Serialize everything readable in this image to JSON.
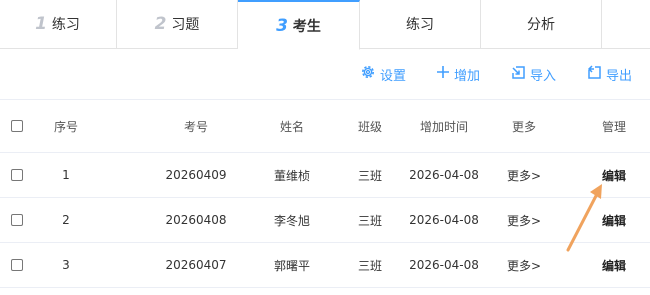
{
  "tabs": [
    {
      "num": "1",
      "label": "练习"
    },
    {
      "num": "2",
      "label": "习题"
    },
    {
      "num": "3",
      "label": "考生"
    },
    {
      "num": "",
      "label": "练习"
    },
    {
      "num": "",
      "label": "分析"
    }
  ],
  "active_tab": 2,
  "toolbar": {
    "settings_label": "设置",
    "add_label": "增加",
    "import_label": "导入",
    "export_label": "导出"
  },
  "table": {
    "headers": {
      "index": "序号",
      "exam_no": "考号",
      "name": "姓名",
      "class": "班级",
      "added_time": "增加时间",
      "more": "更多",
      "manage": "管理"
    },
    "rows": [
      {
        "index": "1",
        "exam_no": "20260409",
        "name": "董维桢",
        "class": "三班",
        "added_time": "2026-04-08",
        "more": "更多>",
        "manage": "编辑"
      },
      {
        "index": "2",
        "exam_no": "20260408",
        "name": "李冬旭",
        "class": "三班",
        "added_time": "2026-04-08",
        "more": "更多>",
        "manage": "编辑"
      },
      {
        "index": "3",
        "exam_no": "20260407",
        "name": "郭曙平",
        "class": "三班",
        "added_time": "2026-04-08",
        "more": "更多>",
        "manage": "编辑"
      }
    ]
  },
  "colors": {
    "accent": "#409eff",
    "annotation_arrow": "#f0a35e"
  }
}
